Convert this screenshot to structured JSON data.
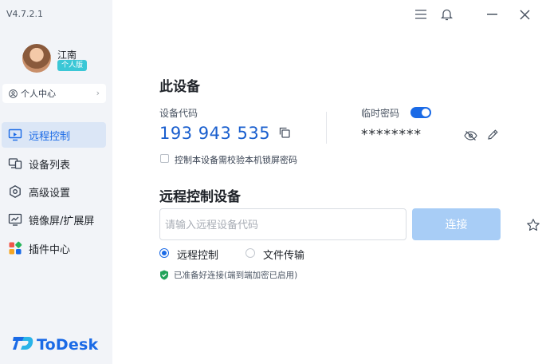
{
  "app": {
    "version": "V4.7.2.1",
    "logo_text": "ToDesk"
  },
  "user": {
    "name": "江南",
    "plan_badge": "个人版",
    "center_label": "个人中心"
  },
  "sidebar": {
    "items": [
      {
        "label": "远程控制",
        "icon": "monitor-icon",
        "active": true
      },
      {
        "label": "设备列表",
        "icon": "devices-icon",
        "active": false
      },
      {
        "label": "高级设置",
        "icon": "settings-icon",
        "active": false
      },
      {
        "label": "镜像屏/扩展屏",
        "icon": "mirror-screen-icon",
        "active": false
      },
      {
        "label": "插件中心",
        "icon": "plugins-icon",
        "active": false
      }
    ]
  },
  "device": {
    "title": "此设备",
    "code_label": "设备代码",
    "code": "193 943 535",
    "temp_pwd_label": "临时密码",
    "temp_pwd_enabled": true,
    "temp_pwd": "********",
    "lock_checkbox_label": "控制本设备需校验本机锁屏密码",
    "lock_checkbox_checked": false
  },
  "remote": {
    "title": "远程控制设备",
    "input_placeholder": "请输入远程设备代码",
    "input_value": "",
    "connect_label": "连接",
    "modes": [
      {
        "label": "远程控制",
        "selected": true
      },
      {
        "label": "文件传输",
        "selected": false
      }
    ],
    "status_text": "已准备好连接(端到端加密已启用)"
  },
  "colors": {
    "accent": "#1a6ae6",
    "sidebar_bg": "#f2f4f8",
    "connect_disabled": "#a8cdf6",
    "badge": "#3bc7d6",
    "status_ok": "#22a35a"
  }
}
